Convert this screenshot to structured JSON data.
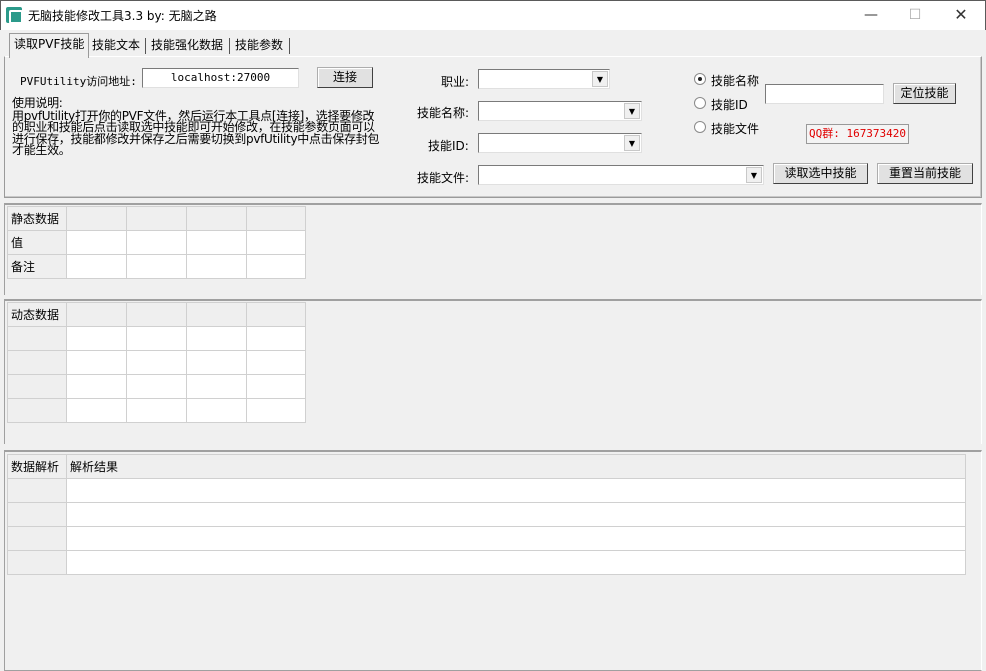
{
  "window": {
    "title": "无脑技能修改工具3.3 by: 无脑之路",
    "minimize_glyph": "—",
    "maximize_glyph": "☐",
    "close_glyph": "✕",
    "icon": "app-icon"
  },
  "tabs": [
    {
      "label": "读取PVF技能"
    },
    {
      "label": "技能文本"
    },
    {
      "label": "技能强化数据"
    },
    {
      "label": "技能参数"
    }
  ],
  "connection": {
    "label": "PVFUtility访问地址:",
    "address_value": "localhost:27000",
    "connect_button": "连接"
  },
  "instructions": {
    "heading": "使用说明:",
    "body": "用pvfUtility打开你的PVF文件，然后运行本工具点[连接]，选择要修改的职业和技能后点击读取选中技能即可开始修改，在技能参数页面可以进行保存，技能都修改并保存之后需要切换到pvfUtility中点击保存封包才能生效。"
  },
  "selectors": {
    "profession_label": "职业:",
    "profession_value": "",
    "skill_name_label": "技能名称:",
    "skill_name_value": "",
    "skill_id_label": "技能ID:",
    "skill_id_value": "",
    "skill_file_label": "技能文件:",
    "skill_file_value": ""
  },
  "search": {
    "options": [
      {
        "label": "技能名称",
        "checked": true
      },
      {
        "label": "技能ID",
        "checked": false
      },
      {
        "label": "技能文件",
        "checked": false
      }
    ],
    "search_value": "",
    "locate_button": "定位技能",
    "qq_group": "QQ群: 167373420"
  },
  "actions": {
    "read_button": "读取选中技能",
    "reset_button": "重置当前技能"
  },
  "static_grid": {
    "header": "静态数据",
    "row_labels": [
      "值",
      "备注"
    ]
  },
  "dynamic_grid": {
    "header": "动态数据"
  },
  "parse_grid": {
    "col1": "数据解析",
    "col2": "解析结果"
  }
}
